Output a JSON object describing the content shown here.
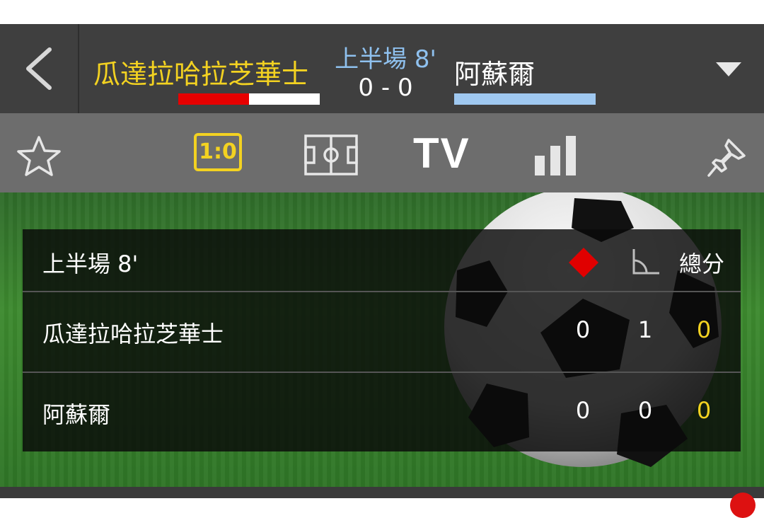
{
  "match": {
    "home_team": "瓜達拉哈拉芝華士",
    "away_team": "阿蘇爾",
    "period": "上半場 8'",
    "score": "0 - 0",
    "home_color": "#e60000",
    "away_color": "#9fc8f0",
    "home_bar_fill_fraction": 0.5
  },
  "toolbar": {
    "favorite_icon": "star-icon",
    "scoreboard_label": "1:0",
    "field_icon": "pitch-icon",
    "tv_label": "TV",
    "stats_icon": "bar-chart-icon",
    "pin_icon": "pin-icon"
  },
  "scoreboard": {
    "period_label": "上半場 8'",
    "columns": {
      "red_card_icon": "red-card-icon",
      "corner_icon": "corner-icon",
      "total_label": "總分"
    },
    "rows": [
      {
        "team": "瓜達拉哈拉芝華士",
        "red_cards": "0",
        "corners": "1",
        "total": "0"
      },
      {
        "team": "阿蘇爾",
        "red_cards": "0",
        "corners": "0",
        "total": "0"
      }
    ]
  },
  "colors": {
    "accent_yellow": "#f3d221",
    "header_bg": "#3f3f3f",
    "toolbar_bg": "#6d6d6d"
  }
}
